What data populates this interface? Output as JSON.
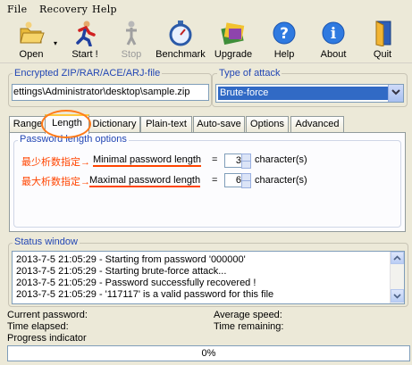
{
  "menu": {
    "file": "File",
    "recovery": "Recovery",
    "help": "Help"
  },
  "toolbar": {
    "open": "Open",
    "start": "Start !",
    "stop": "Stop",
    "benchmark": "Benchmark",
    "upgrade": "Upgrade",
    "help": "Help",
    "about": "About",
    "quit": "Quit"
  },
  "encrypted_file": {
    "label": "Encrypted ZIP/RAR/ACE/ARJ-file",
    "value": "ettings\\Administrator\\desktop\\sample.zip"
  },
  "attack": {
    "label": "Type of attack",
    "value": "Brute-force"
  },
  "tabs": [
    "Range",
    "Length",
    "Dictionary",
    "Plain-text",
    "Auto-save",
    "Options",
    "Advanced"
  ],
  "length_panel": {
    "title": "Password length options",
    "min_annotation": "最少析数指定→",
    "min_label": "Minimal password length",
    "min_value": "3",
    "max_annotation": "最大析数指定→",
    "max_label": "Maximal password length",
    "max_value": "6",
    "equals": "=",
    "unit": "character(s)"
  },
  "status": {
    "title": "Status window",
    "lines": [
      "2013-7-5 21:05:29 - Starting from password '000000'",
      "2013-7-5 21:05:29 - Starting brute-force attack...",
      "2013-7-5 21:05:29 - Password successfully recovered !",
      "2013-7-5 21:05:29 - '117117' is a valid password for this file"
    ]
  },
  "info": {
    "current_password": "Current password:",
    "time_elapsed": "Time elapsed:",
    "progress_indicator": "Progress indicator",
    "average_speed": "Average speed:",
    "time_remaining": "Time remaining:"
  },
  "progress": {
    "text": "0%",
    "value": 0
  },
  "colors": {
    "annotation": "#ff4400",
    "highlight_ring": "#ff7a1a",
    "group_title": "#2246b4",
    "selection": "#316ac5"
  }
}
